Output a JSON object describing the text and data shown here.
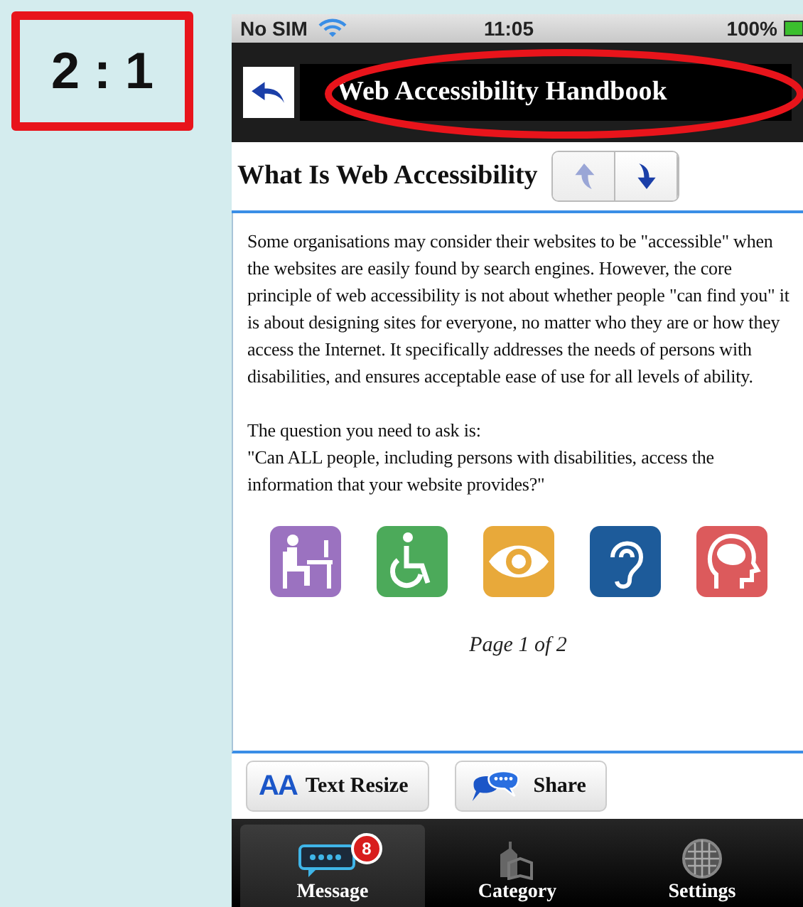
{
  "ratio_label": "2 : 1",
  "status_bar": {
    "carrier": "No SIM",
    "time": "11:05",
    "battery": "100%"
  },
  "nav_bar": {
    "title": "Web Accessibility Handbook"
  },
  "page_header": {
    "title": "What Is Web Accessibility",
    "buttons": [
      {
        "kind": "up",
        "disabled": true
      },
      {
        "kind": "down",
        "disabled": false
      }
    ]
  },
  "body": {
    "paragraph": "Some organisations may consider their websites to be \"accessible\" when the websites are easily found by search engines. However, the core principle of web accessibility is not about whether people \"can find you\" it is about designing sites for everyone, no matter who they are or how they access the Internet. It specifically addresses the needs of persons with disabilities, and ensures acceptable ease of use for all levels of ability.",
    "question_intro": "The question you need to ask is:",
    "question": "\"Can ALL people, including persons with disabilities, access the information that your website provides?\""
  },
  "disability_icons": [
    {
      "kind": "desk",
      "color": "#9b72c0"
    },
    {
      "kind": "wheelchair",
      "color": "#4caa5a"
    },
    {
      "kind": "eye",
      "color": "#e8a93a"
    },
    {
      "kind": "ear",
      "color": "#1d5b9a"
    },
    {
      "kind": "head",
      "color": "#dc5a5c"
    }
  ],
  "pager": "Page 1 of 2",
  "actions": [
    {
      "kind": "text-resize",
      "icon": "AA",
      "label": "Text Resize"
    },
    {
      "kind": "share",
      "label": "Share"
    }
  ],
  "tabs": [
    {
      "kind": "message",
      "label": "Message",
      "badge": "8",
      "selected": true
    },
    {
      "kind": "category",
      "label": "Category",
      "selected": false
    },
    {
      "kind": "settings",
      "label": "Settings",
      "selected": false
    }
  ]
}
